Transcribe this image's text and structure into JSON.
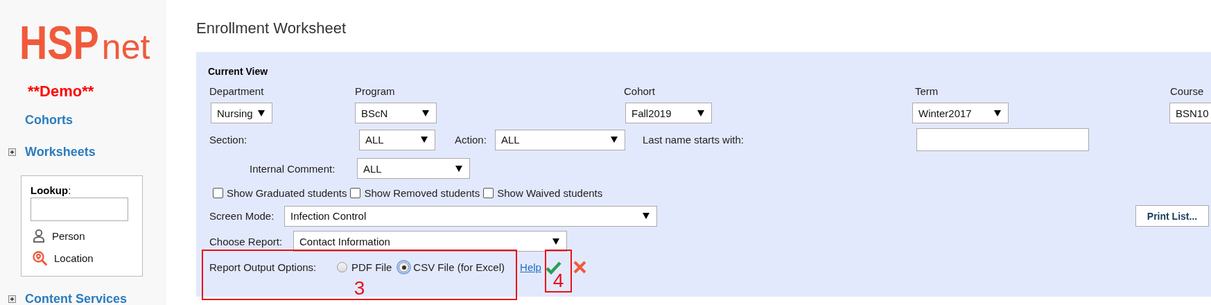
{
  "sidebar": {
    "logo": {
      "heavy": "HSP",
      "light": "net"
    },
    "demo": "**Demo**",
    "nav": [
      {
        "label": "Cohorts",
        "expandable": false
      },
      {
        "label": "Worksheets",
        "expandable": true
      }
    ],
    "lookup": {
      "label": "Lookup",
      "colon": ":",
      "links": [
        {
          "kind": "person",
          "label": "Person"
        },
        {
          "kind": "location",
          "label": "Location"
        }
      ]
    },
    "bottom_nav": {
      "label": "Content Services",
      "expandable": true
    }
  },
  "main": {
    "title": "Enrollment Worksheet",
    "current_view": {
      "heading": "Current View",
      "filters": [
        {
          "label": "Department",
          "value": "Nursing"
        },
        {
          "label": "Program",
          "value": "BScN"
        },
        {
          "label": "Cohort",
          "value": "Fall2019"
        },
        {
          "label": "Term",
          "value": "Winter2017"
        },
        {
          "label": "Course",
          "value": "BSN10"
        }
      ],
      "section": {
        "label": "Section:",
        "value": "ALL"
      },
      "action": {
        "label": "Action:",
        "value": "ALL"
      },
      "last_name": {
        "label": "Last name starts with:"
      },
      "internal_comment": {
        "label": "Internal Comment:",
        "value": "ALL"
      },
      "checkboxes": [
        {
          "label": "Show Graduated students",
          "checked": false
        },
        {
          "label": "Show Removed students",
          "checked": false
        },
        {
          "label": "Show Waived students",
          "checked": false
        }
      ],
      "screen_mode": {
        "label": "Screen Mode:",
        "value": "Infection Control"
      },
      "print_button": "Print List...",
      "choose_report": {
        "label": "Choose Report:",
        "value": "Contact Information"
      },
      "output_options": {
        "label": "Report Output Options:",
        "radios": [
          {
            "label": "PDF File",
            "selected": false
          },
          {
            "label": "CSV File (for Excel)",
            "selected": true
          }
        ],
        "help": "Help"
      }
    },
    "annotations": [
      {
        "number": "3"
      },
      {
        "number": "4"
      }
    ]
  }
}
